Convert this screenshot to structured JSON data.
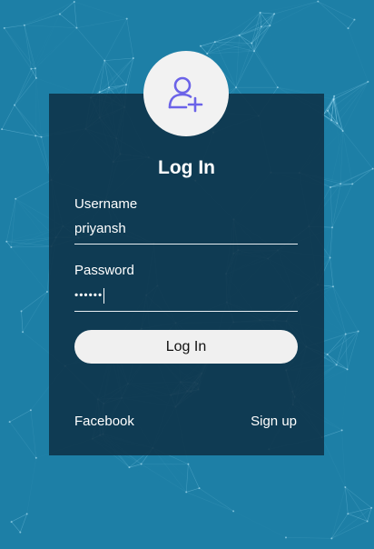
{
  "form": {
    "title": "Log In",
    "username_label": "Username",
    "username_value": "priyansh",
    "password_label": "Password",
    "password_value": "••••••",
    "login_button": "Log In",
    "facebook_link": "Facebook",
    "signup_link": "Sign up"
  },
  "icons": {
    "avatar": "add-user-icon"
  },
  "colors": {
    "background": "#1d7fa6",
    "card": "#0e344a",
    "icon_accent": "#6b63e8",
    "button": "#f0f0f0"
  }
}
